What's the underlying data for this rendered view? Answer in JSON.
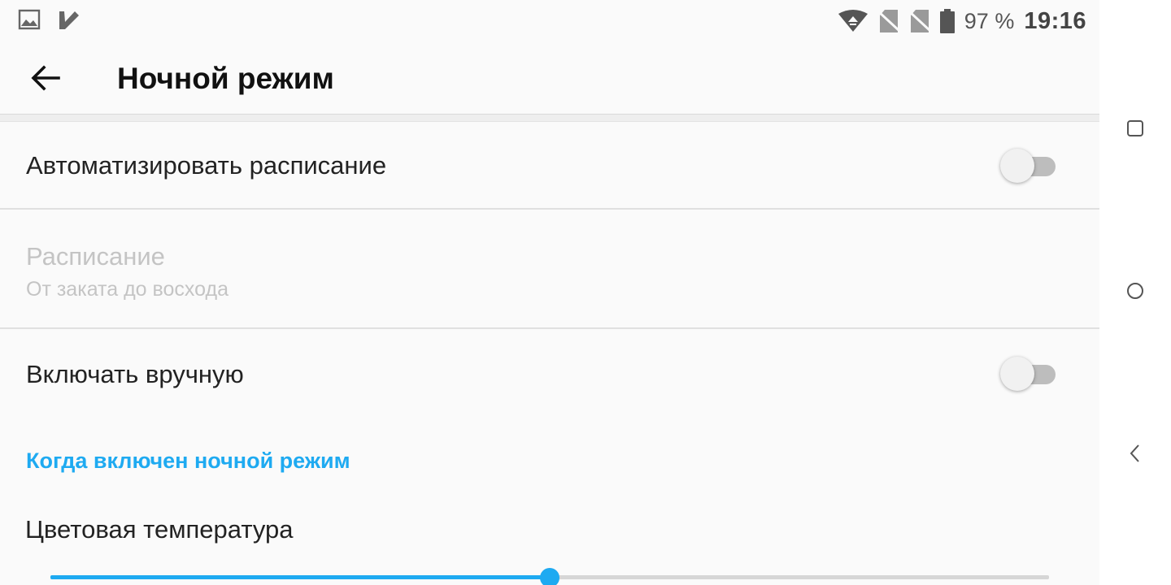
{
  "status_bar": {
    "left_icons": [
      "image-icon",
      "check-app-icon"
    ],
    "right_icons": [
      "wifi-icon",
      "no-sim-icon",
      "no-sim-icon",
      "battery-icon"
    ],
    "battery": "97 %",
    "time": "19:16"
  },
  "toolbar": {
    "back_icon": "arrow-left-icon",
    "title": "Ночной режим"
  },
  "settings": {
    "auto_schedule": {
      "title": "Автоматизировать расписание",
      "enabled": false
    },
    "schedule": {
      "title": "Расписание",
      "summary": "От заката до восхода",
      "disabled": true
    },
    "manual": {
      "title": "Включать вручную",
      "enabled": false
    },
    "section_header": "Когда включен ночной режим",
    "color_temp": {
      "title": "Цветовая температура",
      "value_fraction": 0.5
    }
  },
  "nav_bar": {
    "icons": [
      "square-recents-icon",
      "circle-home-icon",
      "triangle-back-icon"
    ]
  },
  "colors": {
    "accent": "#1eaaf1",
    "background": "#fafafa",
    "disabled_text": "#c4c4c4"
  }
}
